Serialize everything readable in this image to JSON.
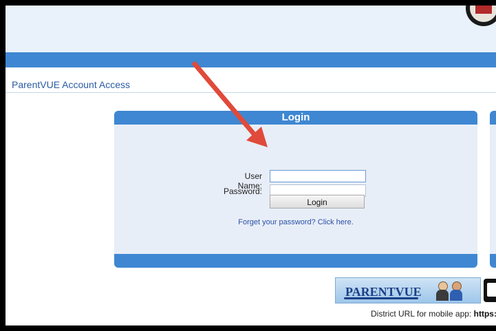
{
  "page": {
    "title": "ParentVUE Account Access"
  },
  "login": {
    "panel_title": "Login",
    "username_label": "User Name:",
    "username_value": "",
    "password_label": "Password:",
    "password_value": "",
    "login_button": "Login",
    "forgot_link": "Forget your password? Click here."
  },
  "footer": {
    "logo_text": "PARENTVUE",
    "district_url_label": "District URL for mobile app:",
    "district_url_value": "https:"
  },
  "icons": [
    "district-crest-icon",
    "parents-icon",
    "mobile-app-icon",
    "annotation-arrow-icon"
  ],
  "colors": {
    "accent_blue": "#3f87d2",
    "panel_bg": "#e8eef7",
    "title_text": "#2a5ba3",
    "link": "#2a4fa8",
    "annotation_arrow": "#e04a3a"
  }
}
